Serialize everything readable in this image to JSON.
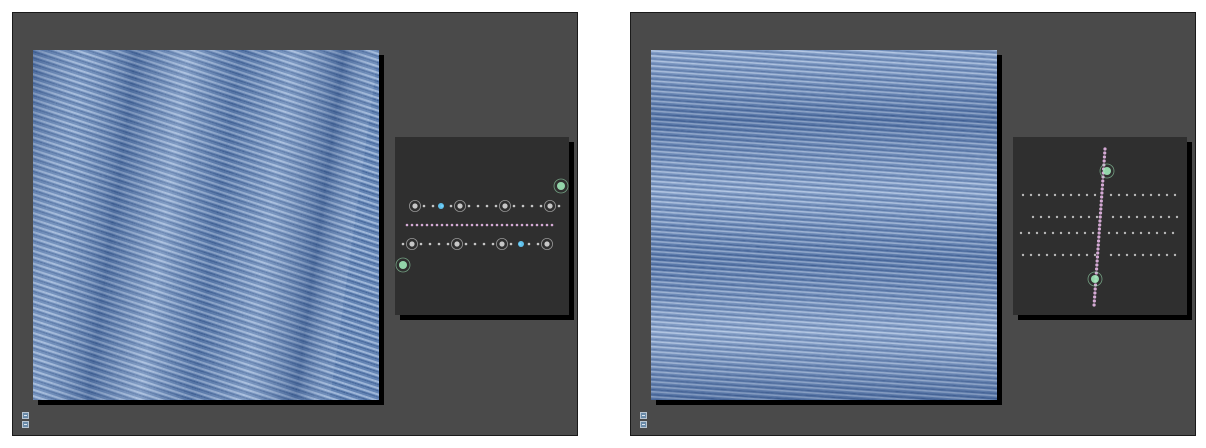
{
  "colors": {
    "panel_bg": "#4a4a4a",
    "image_base": "#5c7eb0",
    "image_light": "#c8d8f0",
    "image_dark": "#2a4a80",
    "fft_bg": "#2f2f2f",
    "spot_green": "#9fe8b8",
    "spot_pink": "#e8b8e8",
    "spot_orange": "#f0c0a0"
  },
  "panels": [
    {
      "texture": "diagonal-stripes",
      "fft_pattern": "horizontal-rows",
      "icons": [
        "zoom-icon",
        "settings-icon"
      ]
    },
    {
      "texture": "horizontal-fringes",
      "fft_pattern": "vertical-column",
      "icons": [
        "zoom-icon",
        "settings-icon"
      ]
    }
  ]
}
